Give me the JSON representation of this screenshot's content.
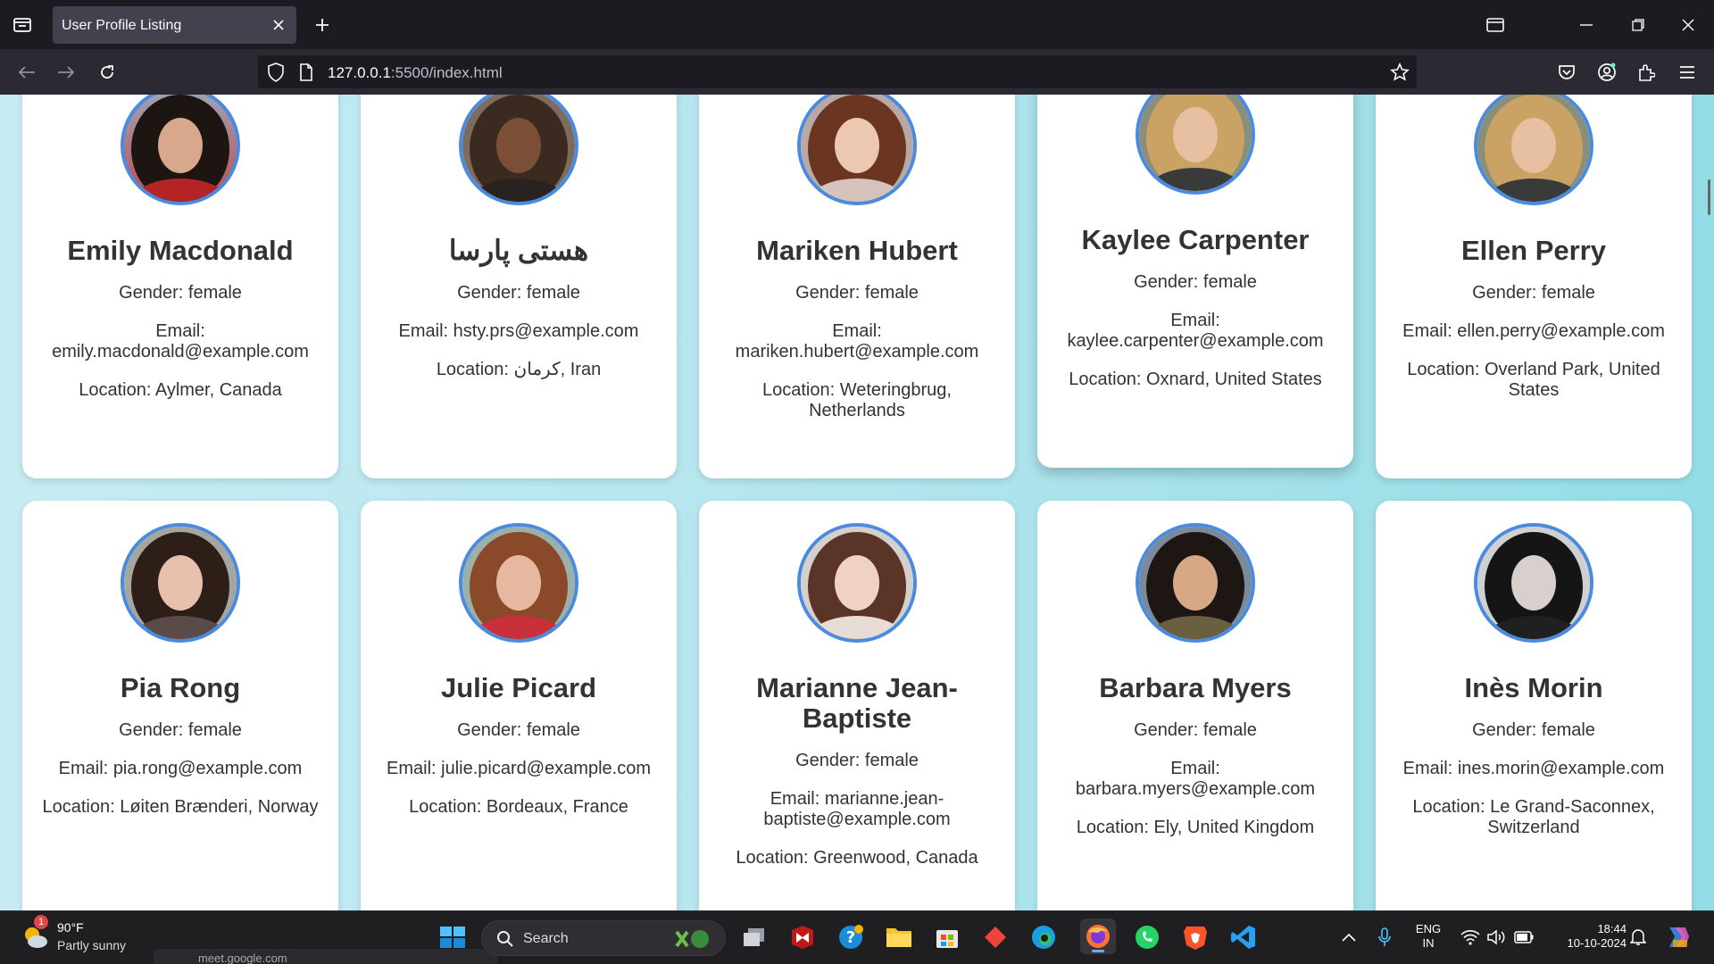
{
  "browser": {
    "tab_title": "User Profile Listing",
    "url_host": "127.0.0.1",
    "url_path": ":5500/index.html"
  },
  "profiles": [
    {
      "name": "Emily Macdonald",
      "gender": "Gender: female",
      "email_label": "Email:",
      "email": "emily.macdonald@example.com",
      "location": "Location: Aylmer, Canada"
    },
    {
      "name": "هستی پارسا",
      "gender": "Gender: female",
      "email_label": "Email:",
      "email": "hsty.prs@example.com",
      "location": "Location: کرمان, Iran"
    },
    {
      "name": "Mariken Hubert",
      "gender": "Gender: female",
      "email_label": "Email:",
      "email": "mariken.hubert@example.com",
      "location": "Location: Weteringbrug, Netherlands"
    },
    {
      "name": "Kaylee Carpenter",
      "gender": "Gender: female",
      "email_label": "Email:",
      "email": "kaylee.carpenter@example.com",
      "location": "Location: Oxnard, United States"
    },
    {
      "name": "Ellen Perry",
      "gender": "Gender: female",
      "email_label": "Email:",
      "email": "ellen.perry@example.com",
      "location": "Location: Overland Park, United States"
    },
    {
      "name": "Pia Rong",
      "gender": "Gender: female",
      "email_label": "Email:",
      "email": "pia.rong@example.com",
      "location": "Location: Løiten Brænderi, Norway"
    },
    {
      "name": "Julie Picard",
      "gender": "Gender: female",
      "email_label": "Email:",
      "email": "julie.picard@example.com",
      "location": "Location: Bordeaux, France"
    },
    {
      "name": "Marianne Jean-Baptiste",
      "gender": "Gender: female",
      "email_label": "Email:",
      "email": "marianne.jean-baptiste@example.com",
      "location": "Location: Greenwood, Canada"
    },
    {
      "name": "Barbara Myers",
      "gender": "Gender: female",
      "email_label": "Email:",
      "email": "barbara.myers@example.com",
      "location": "Location: Ely, United Kingdom"
    },
    {
      "name": "Inès Morin",
      "gender": "Gender: female",
      "email_label": "Email:",
      "email": "ines.morin@example.com",
      "location": "Location: Le Grand-Saconnex, Switzerland"
    }
  ],
  "taskbar": {
    "weather_temp": "90°F",
    "weather_desc": "Partly sunny",
    "weather_badge": "1",
    "search_label": "Search",
    "meet_hint": "meet.google.com",
    "lang_top": "ENG",
    "lang_bottom": "IN",
    "time": "18:44",
    "date": "10-10-2024"
  }
}
